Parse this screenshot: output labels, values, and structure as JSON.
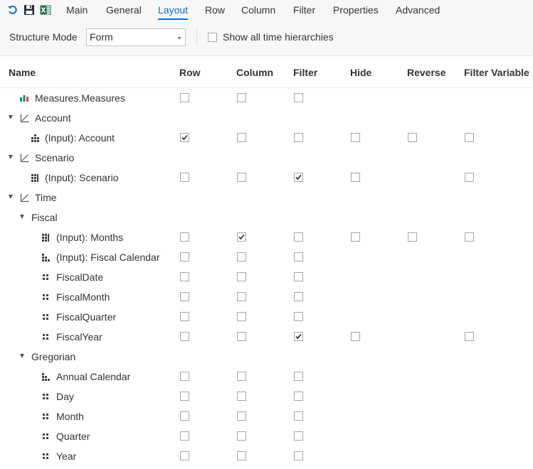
{
  "tabs": [
    {
      "label": "Main"
    },
    {
      "label": "General"
    },
    {
      "label": "Layout"
    },
    {
      "label": "Row"
    },
    {
      "label": "Column"
    },
    {
      "label": "Filter"
    },
    {
      "label": "Properties"
    },
    {
      "label": "Advanced"
    }
  ],
  "active_tab": "Layout",
  "options": {
    "structure_mode_label": "Structure Mode",
    "structure_mode_value": "Form",
    "show_time_hierarchies_label": "Show all time hierarchies",
    "show_time_hierarchies_checked": false
  },
  "columns": {
    "name": "Name",
    "row": "Row",
    "column": "Column",
    "filter": "Filter",
    "hide": "Hide",
    "reverse": "Reverse",
    "filter_variable": "Filter Variable"
  },
  "rows": [
    {
      "label": "Measures.Measures",
      "icon": "measures-icon"
    },
    {
      "label": "Account",
      "icon": "hierarchy-icon"
    },
    {
      "label": "(Input): Account",
      "icon": "input-dimension-icon"
    },
    {
      "label": "Scenario",
      "icon": "hierarchy-icon"
    },
    {
      "label": "(Input): Scenario",
      "icon": "input-grid-icon"
    },
    {
      "label": "Time",
      "icon": "hierarchy-icon"
    },
    {
      "label": "Fiscal",
      "icon": ""
    },
    {
      "label": "(Input): Months",
      "icon": "input-grid-icon"
    },
    {
      "label": "(Input): Fiscal Calendar",
      "icon": "calendar-hierarchy-icon"
    },
    {
      "label": "FiscalDate",
      "icon": "level-icon"
    },
    {
      "label": "FiscalMonth",
      "icon": "level-icon"
    },
    {
      "label": "FiscalQuarter",
      "icon": "level-icon"
    },
    {
      "label": "FiscalYear",
      "icon": "level-icon"
    },
    {
      "label": "Gregorian",
      "icon": ""
    },
    {
      "label": "Annual Calendar",
      "icon": "calendar-hierarchy-icon"
    },
    {
      "label": "Day",
      "icon": "level-icon"
    },
    {
      "label": "Month",
      "icon": "level-icon"
    },
    {
      "label": "Quarter",
      "icon": "level-icon"
    },
    {
      "label": "Year",
      "icon": "level-icon"
    }
  ],
  "checks": {
    "input_account_row": true,
    "input_scenario_filter": true,
    "input_months_column": true,
    "fiscalyear_filter": true
  },
  "colors": {
    "accent": "#0a6ed1",
    "excel_green": "#1e7145"
  }
}
